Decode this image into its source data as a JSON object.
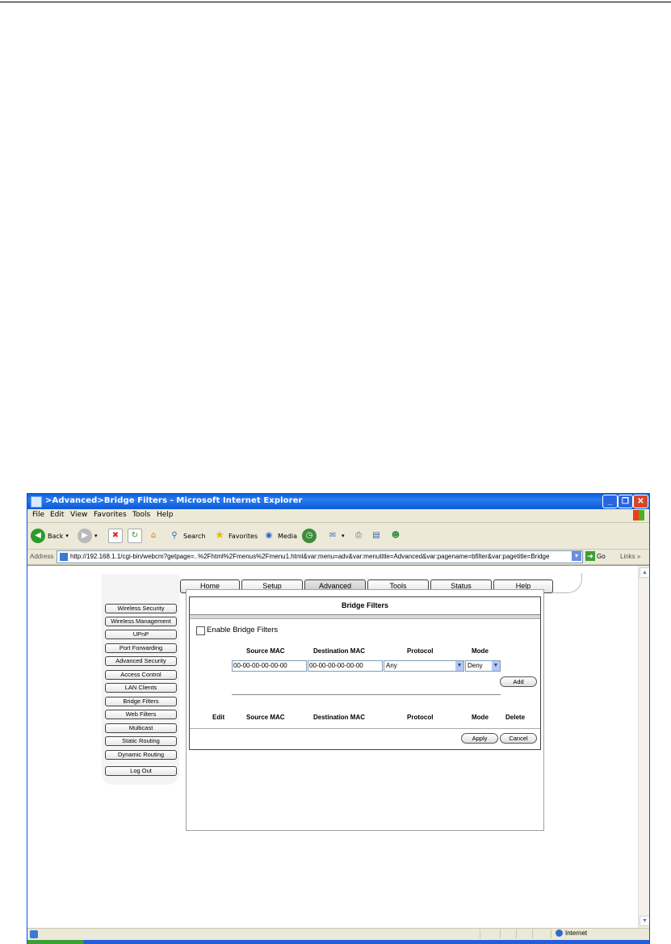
{
  "window": {
    "title": ">Advanced>Bridge Filters - Microsoft Internet Explorer"
  },
  "menubar": [
    "File",
    "Edit",
    "View",
    "Favorites",
    "Tools",
    "Help"
  ],
  "toolbar": {
    "back_label": "Back",
    "search_label": "Search",
    "favorites_label": "Favorites",
    "media_label": "Media"
  },
  "addressbar": {
    "label": "Address",
    "url": "http://192.168.1.1/cgi-bin/webcm?getpage=..%2Fhtml%2Fmenus%2Fmenu1.html&var:menu=adv&var:menutitle=Advanced&var:pagename=bfilter&var:pagetitle=Bridge",
    "go_label": "Go",
    "links_label": "Links"
  },
  "nav_tabs": [
    "Home",
    "Setup",
    "Advanced",
    "Tools",
    "Status",
    "Help"
  ],
  "nav_active": "Advanced",
  "sidebar_items": [
    "Wireless Security",
    "Wireless Management",
    "UPnP",
    "Port Forwarding",
    "Advanced Security",
    "Access Control",
    "LAN Clients",
    "Bridge Filters",
    "Web Filters",
    "Multicast",
    "Static Routing",
    "Dynamic Routing",
    "Log Out"
  ],
  "panel": {
    "title": "Bridge Filters",
    "enable_label": "Enable Bridge Filters",
    "enable_checked": false,
    "headers": {
      "source_mac": "Source MAC",
      "destination_mac": "Destination MAC",
      "protocol": "Protocol",
      "mode": "Mode"
    },
    "source_mac_value": "00-00-00-00-00-00",
    "destination_mac_value": "00-00-00-00-00-00",
    "protocol_value": "Any",
    "mode_value": "Deny",
    "add_label": "Add",
    "list_headers": {
      "edit": "Edit",
      "source_mac": "Source MAC",
      "destination_mac": "Destination MAC",
      "protocol": "Protocol",
      "mode": "Mode",
      "delete": "Delete"
    },
    "apply_label": "Apply",
    "cancel_label": "Cancel"
  },
  "statusbar": {
    "zone_label": "Internet"
  }
}
